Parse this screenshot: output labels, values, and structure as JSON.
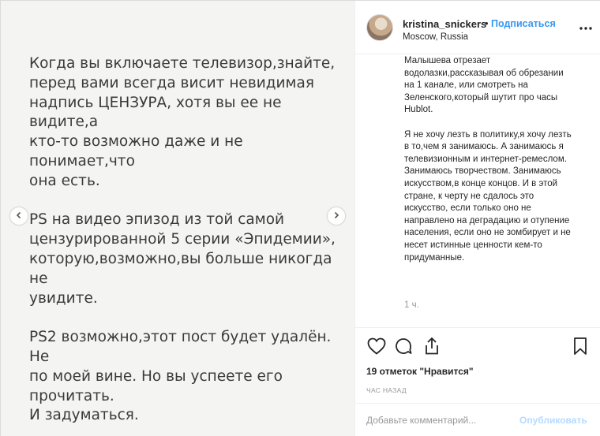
{
  "image": {
    "paragraphs": [
      "Когда вы включаете телевизор,знайте,\nперед вами всегда висит невидимая\nнадпись ЦЕНЗУРА, хотя вы ее не видите,а\nкто-то возможно даже и не понимает,что\nона есть.",
      "PS на видео эпизод из той самой\nцензурированной 5 серии «Эпидемии»,\nкоторую,возможно,вы больше никогда не\nувидите.",
      "PS2 возможно,этот пост будет удалён. Не\nпо моей вине. Но вы успеете его прочитать.\nИ задуматься."
    ],
    "prev_icon": "chevron-left-icon",
    "next_icon": "chevron-right-icon"
  },
  "header": {
    "username": "kristina_snickers",
    "separator": "•",
    "follow_label": "Подписаться",
    "location": "Moscow, Russia",
    "more_icon": "more-horizontal-icon"
  },
  "caption": {
    "paragraphs": [
      "Малышева отрезает водолазки,рассказывая об обрезании на 1 канале, или смотреть на Зеленского,который шутит про часы Hublot.",
      "Я не хочу лезть в политику,я хочу лезть в то,чем я занимаюсь. А занимаюсь я телевизионным и интернет-ремеслом. Занимаюсь творчеством. Занимаюсь искусством,в конце концов. И в этой стране, к черту не сдалось это искусство, если только оно не направлено на деградацию и отупение населения, если оно не зомбирует и не несет истинные ценности кем-то придуманные."
    ],
    "time": "1 ч."
  },
  "actions": {
    "like_icon": "heart-icon",
    "comment_icon": "comment-icon",
    "share_icon": "share-icon",
    "save_icon": "bookmark-icon",
    "likes_text": "19 отметок \"Нравится\"",
    "ago_text": "ЧАС НАЗАД"
  },
  "comment_box": {
    "placeholder": "Добавьте комментарий...",
    "publish_label": "Опубликовать"
  },
  "colors": {
    "link_blue": "#3897f0",
    "publish_disabled": "#b3dbff",
    "text": "#262626",
    "muted": "#999999",
    "image_bg": "#f4f4f2"
  }
}
